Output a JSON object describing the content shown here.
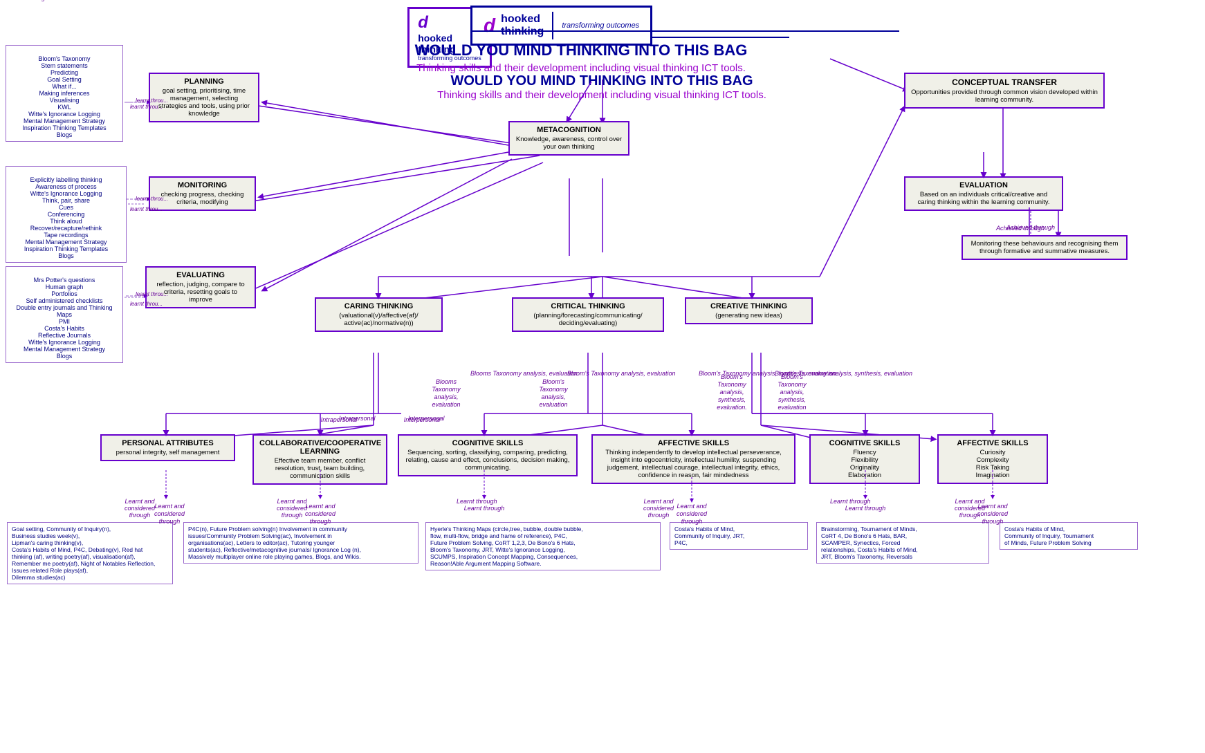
{
  "header": {
    "logo_icon": "d",
    "logo_text1": "hooked",
    "logo_text2": "thinking",
    "logo_tagline": "transforming outcomes",
    "main_title": "WOULD YOU MIND THINKING INTO THIS BAG",
    "sub_title": "Thinking skills and their development including visual thinking ICT tools."
  },
  "boxes": {
    "planning": {
      "title": "PLANNING",
      "content": "goal setting, prioritising, time management, selecting strategies and tools, using prior knowledge"
    },
    "metacognition": {
      "title": "METACOGNITION",
      "content": "Knowledge, awareness, control over your own thinking"
    },
    "monitoring": {
      "title": "MONITORING",
      "content": "checking progress, checking criteria, modifying"
    },
    "evaluating": {
      "title": "EVALUATING",
      "content": "reflection, judging, compare to criteria, resetting goals to improve"
    },
    "caring_thinking": {
      "title": "CARING THINKING",
      "content": "(valuational(v)/affective(af)/ active(ac)/normative(n))"
    },
    "critical_thinking": {
      "title": "CRITICAL THINKING",
      "content": "(planning/forecasting/communicating/ deciding/evaluating)"
    },
    "creative_thinking": {
      "title": "CREATIVE THINKING",
      "content": "(generating new ideas)"
    },
    "conceptual_transfer": {
      "title": "CONCEPTUAL TRANSFER",
      "content": "Opportunities provided through common vision developed within learning community."
    },
    "evaluation": {
      "title": "EVALUATION",
      "content": "Based on an individuals critical/creative and caring thinking within the learning community."
    },
    "monitoring_behaviours": {
      "title": "",
      "content": "Monitoring these behaviours and recognising them through formative and summative measures."
    },
    "personal_attributes": {
      "title": "PERSONAL ATTRIBUTES",
      "content": "personal integrity, self management"
    },
    "collaborative": {
      "title": "COLLABORATIVE/COOPERATIVE LEARNING",
      "content": "Effective team member, conflict resolution, trust, team building, communication skills"
    },
    "cognitive_skills_mid": {
      "title": "COGNITIVE SKILLS",
      "content": "Sequencing, sorting, classifying, comparing, predicting, relating, cause and effect, conclusions, decision making, communicating."
    },
    "affective_skills_mid": {
      "title": "AFFECTIVE SKILLS",
      "content": "Thinking independently to develop intellectual perseverance, insight into egocentricity, intellectual humility, suspending judgement, intellectual courage, intellectual integrity, ethics, confidence in reason, fair mindedness"
    },
    "cognitive_skills_right": {
      "title": "COGNITIVE SKILLS",
      "content": "Fluency\nFlexibility\nOriginality\nElaboration"
    },
    "affective_skills_right": {
      "title": "AFFECTIVE SKILLS",
      "content": "Curiosity\nComplexity\nRisk Taking\nImagination"
    }
  },
  "left_panels": {
    "panel1": {
      "content": "Bloom's Taxonomy\nStem statements\nPredicting\nGoal Setting\nWhat if...\nMaking inferences\nVisualising\nKWL\nWitte's Ignorance Logging\nMental Management Strategy\nInspiration Thinking Templates\nBlogs"
    },
    "panel2": {
      "content": "Explicitly labelling thinking\nAwareness of process\nWitte's Ignorance Logging\nThink, pair, share\nCues\nConferencing\nThink aloud\nRecover/recapture/rethink\nTape recordings\nMental Management Strategy\nInspiration Thinking Templates\nBlogs"
    },
    "panel3": {
      "content": "Mrs Potter's questions\nHuman graph\nPortfolios\nSelf administered checklists\nDouble entry journals and Thinking Maps\nPMI\nCosta's Habits\nReflective Journals\nWitte's Ignorance Logging\nMental Management Strategy\nBlogs"
    }
  },
  "labels": {
    "learnt_through1": "Learnt throu...",
    "learnt_through2": "Learnt throu...",
    "learnt_through3": "Learnt throu...",
    "intrapersonal": "Intrapersonal",
    "interpersonal": "Interpersonal",
    "blooms1": "Blooms\nTaxonomy\nanalysis,\nevaluation",
    "blooms2": "Bloom's\nTaxonomy\nanalysis,\nevaluation",
    "blooms3": "Bloom's\nTaxonomy\nanalysis,\nsynthesis,\nevaluation.",
    "blooms4": "Bloom's\nTaxonomy\nanalysis,\nsynthesis,\nevaluation",
    "achieved_through": "Achieved through",
    "learnt_considered1": "Learnt and\nconsidered\nthrough",
    "learnt_considered2": "Learnt and\nconsidered\nthrough",
    "learnt_through_mid": "Learnt through",
    "learnt_considered3": "Learnt and\nconsidered\nthrough",
    "learnt_through_r": "Learnt through",
    "learnt_considered4": "Learnt and\nconsidered\nthrough"
  },
  "bottom_texts": {
    "bt1": "Goal setting, Community of Inquiry(n),\nBusiness studies week(v),\nLipman's caring thinking(v),\nCosta's Habits of Mind, P4C, Debating(v), Red hat\nthinking (af), writing poetry(af), visualisation(af),\nRemember me poetry(af), Night of Notables Reflection,\nIssues related Role plays(af),\nDilemma studies(ac)",
    "bt2": "P4C(n), Future Problem solving(n) Involvement in community\nissues/Community Problem Solving(ac), Involvement in\norganisations(ac), Letters to editor(ac), Tutoring younger\nstudents(ac), Reflective/metacognitive journals/ Ignorance Log (n),\nMassively multiplayer online role playing games, Blogs, and Wikis.",
    "bt3": "Hyerle's Thinking Maps (circle,tree, bubble, double bubble,\nflow, multi-flow, bridge and frame of reference), P4C,\nFuture Problem Solving, CoRT 1,2,3, De Bono's 6 Hats,\nBloom's Taxonomy, JRT, Witte's Ignorance Logging,\nSCUMPS, Inspiration Concept Mapping, Consequences,\nReason!Able Argument Mapping Software.",
    "bt4": "Costa's Habits of Mind,\nCommunity of Inquiry, JRT,\nP4C,",
    "bt5": "Brainstorming, Tournament of Minds,\nCoRT 4, De Bono's 6 Hats, BAR,\nSCAMPER, Synectics, Forced\nrelationships, Costa's Habits of Mind,\nJRT, Bloom's Taxonomy, Reversals",
    "bt6": "Costa's Habits of Mind,\nCommunity of Inquiry, Tournament\nof Minds, Future Problem Solving"
  }
}
